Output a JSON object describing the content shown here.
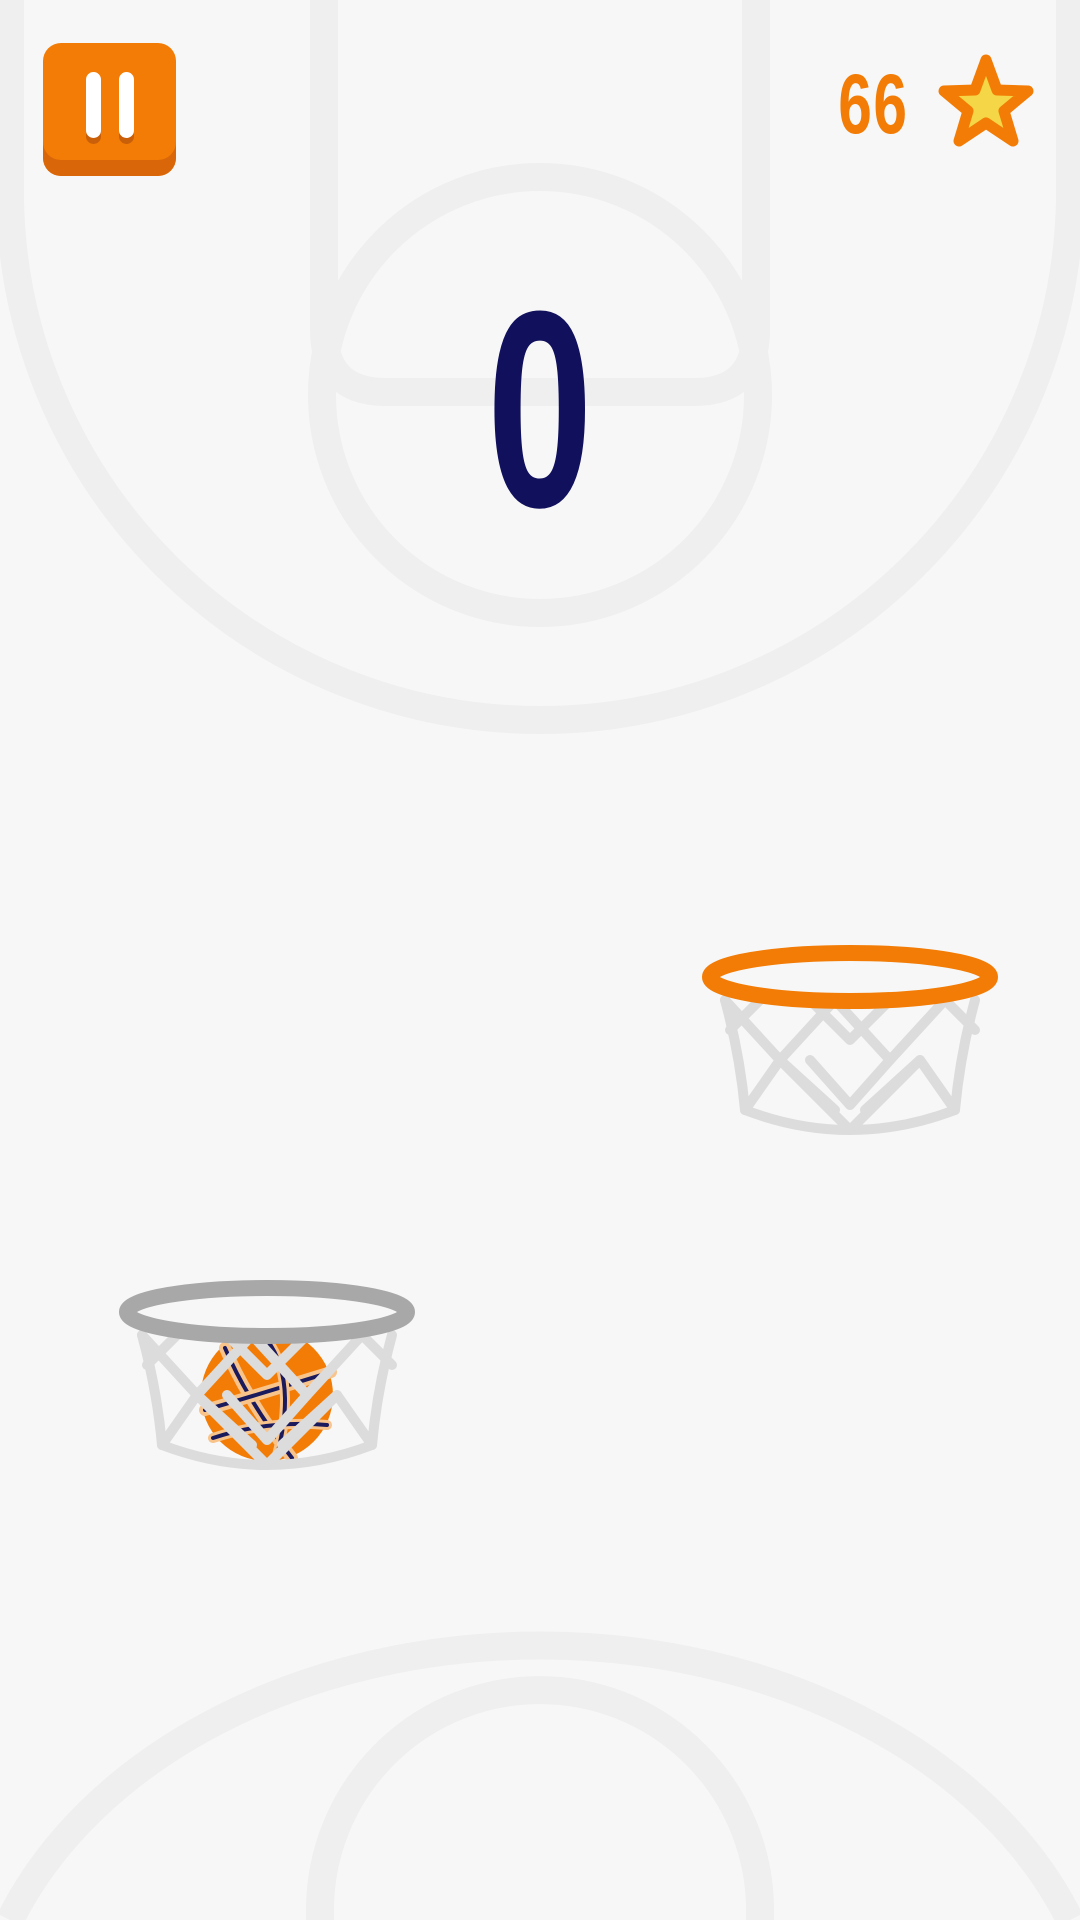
{
  "hud": {
    "score": "0",
    "star_count": "66",
    "pause_icon": "pause-icon",
    "star_icon": "star-icon"
  },
  "colors": {
    "background": "#f7f7f7",
    "court_lines": "#efefef",
    "accent_orange": "#f27c05",
    "score_navy": "#10105c",
    "star_fill": "#f5d646",
    "rim_active": "#f27c05",
    "rim_inactive": "#a8a8a8",
    "net": "#dcdcdc",
    "ball": "#f27c05"
  },
  "hoops": [
    {
      "name": "target-hoop",
      "rim_state": "active"
    },
    {
      "name": "current-hoop",
      "rim_state": "inactive",
      "holds_ball": true
    }
  ]
}
